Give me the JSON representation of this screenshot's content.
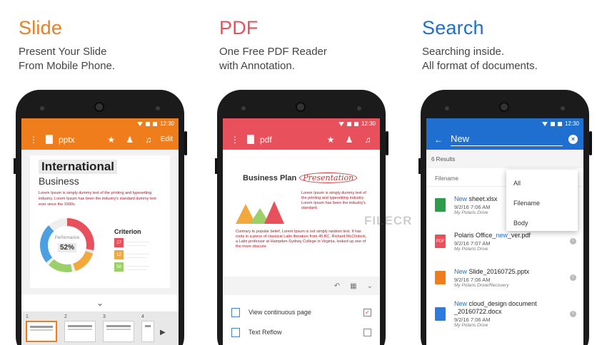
{
  "colors": {
    "slide": "#f07d1c",
    "pdf": "#e8505b",
    "search": "#1e6fd0"
  },
  "panels": [
    {
      "title": "Slide",
      "sub1": "Present Your Slide",
      "sub2": "From Mobile Phone."
    },
    {
      "title": "PDF",
      "sub1": "One Free PDF Reader",
      "sub2": "with Annotation."
    },
    {
      "title": "Search",
      "sub1": "Searching inside.",
      "sub2": "All format of documents."
    }
  ],
  "status_time": "12:30",
  "slide_screen": {
    "title": "pptx",
    "edit": "Edit",
    "heading1": "International",
    "heading2": "Business",
    "body": "Lorem Ipsum is simply dummy text of the printing and typesetting industry. Lorem Ipsum has been the industry's standard dummy text ever since the 1500s.",
    "perf_label": "Performance",
    "perf_value": "52%",
    "criterion": "Criterion",
    "criteria": [
      {
        "n": "27",
        "color": "#e8505b"
      },
      {
        "n": "12",
        "color": "#f3a83b"
      },
      {
        "n": "58",
        "color": "#9bcf67"
      }
    ],
    "thumbs": [
      "1",
      "2",
      "3",
      "4"
    ]
  },
  "pdf_screen": {
    "title": "pdf",
    "heading": "Business Plan",
    "annotation": "Presentation",
    "body1": "Lorem Ipsum is simply dummy text of the printing and typesetting industry. Lorem Ipsum has been the industry's standard.",
    "body2": "Contrary to popular belief, Lorem Ipsum is not simply random text. It has roots in a piece of classical Latin literature from 45 BC. Richard McClintock, a Latin professor at Hampden-Sydney College in Virginia, looked up one of the more obscure",
    "menu": [
      {
        "label": "View continuous page",
        "checked": true
      },
      {
        "label": "Text Reflow",
        "checked": false
      }
    ]
  },
  "search_screen": {
    "query": "New",
    "results": "6 Results",
    "filename_header": "Filename",
    "dropdown": [
      "All",
      "Filename",
      "Body"
    ],
    "files": [
      {
        "hl": "New",
        "rest": " sheet.xlsx",
        "date": "9/2/16 7:06 AM",
        "drive": "My Polaris Drive",
        "color": "#2e9d4a",
        "glyph": ""
      },
      {
        "pre": "Polaris Office_",
        "hl": "new",
        "rest": "_ver.pdf",
        "date": "9/2/16 7:07 AM",
        "drive": "My Polaris Drive",
        "color": "#e8505b",
        "glyph": "PDF"
      },
      {
        "hl": "New",
        "rest": " Slide_20160725.pptx",
        "date": "9/2/16 7:06 AM",
        "drive": "My Polaris Drive/Recovery",
        "color": "#f07d1c",
        "glyph": ""
      },
      {
        "hl": "New",
        "rest": " cloud_design document _20160722.docx",
        "date": "9/2/16 7:06 AM",
        "drive": "My Polaris Drive",
        "color": "#2d7be0",
        "glyph": ""
      }
    ]
  },
  "watermark": "FILECR"
}
